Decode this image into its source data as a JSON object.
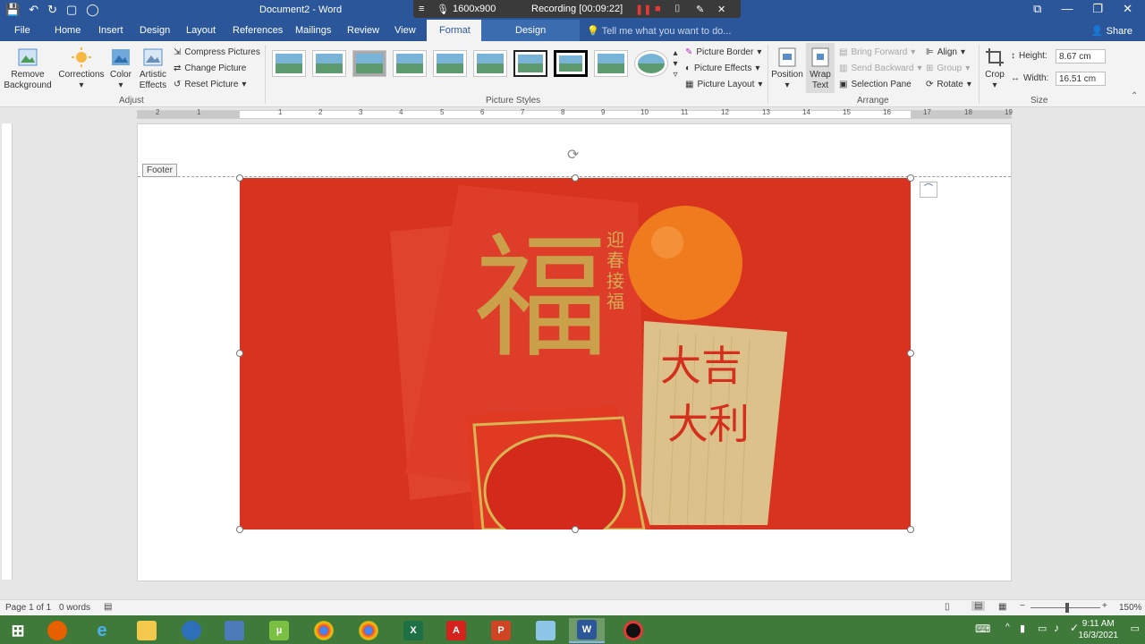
{
  "title_bar": {
    "document_title": "Document2 - Word"
  },
  "recording_bar": {
    "resolution": "1600x900",
    "status": "Recording [00:09:22]"
  },
  "ribbon_tabs": [
    {
      "label": "File"
    },
    {
      "label": "Home"
    },
    {
      "label": "Insert"
    },
    {
      "label": "Design"
    },
    {
      "label": "Layout"
    },
    {
      "label": "References"
    },
    {
      "label": "Mailings"
    },
    {
      "label": "Review"
    },
    {
      "label": "View"
    },
    {
      "label": "Format"
    },
    {
      "label": "Design"
    }
  ],
  "tell_me": {
    "placeholder": "Tell me what you want to do..."
  },
  "share_label": "Share",
  "adjust": {
    "remove_background": "Remove Background",
    "corrections": "Corrections",
    "color": "Color",
    "artistic_effects": "Artistic Effects",
    "compress_pictures": "Compress Pictures",
    "change_picture": "Change Picture",
    "reset_picture": "Reset Picture",
    "group_label": "Adjust"
  },
  "picture_styles": {
    "picture_border": "Picture Border",
    "picture_effects": "Picture Effects",
    "picture_layout": "Picture Layout",
    "group_label": "Picture Styles"
  },
  "arrange": {
    "position": "Position",
    "wrap_text": "Wrap Text",
    "bring_forward": "Bring Forward",
    "send_backward": "Send Backward",
    "selection_pane": "Selection Pane",
    "align": "Align",
    "group": "Group",
    "rotate": "Rotate",
    "group_label": "Arrange"
  },
  "size": {
    "crop": "Crop",
    "height_label": "Height:",
    "height_value": "8.67 cm",
    "width_label": "Width:",
    "width_value": "16.51 cm",
    "group_label": "Size"
  },
  "ruler_numbers": [
    "2",
    "1",
    "1",
    "2",
    "3",
    "4",
    "5",
    "6",
    "7",
    "8",
    "9",
    "10",
    "11",
    "12",
    "13",
    "14",
    "15",
    "16",
    "17",
    "18",
    "19"
  ],
  "document": {
    "footer_label": "Footer",
    "picture_texts": {
      "left_char": "福",
      "vertical_text": "迎春接福",
      "card_line_1": "大吉",
      "card_line_2": "大利"
    }
  },
  "status_bar": {
    "page": "Page 1 of 1",
    "words": "0 words",
    "zoom": "150%"
  },
  "taskbar": {
    "time": "9:11 AM",
    "date": "16/3/2021"
  },
  "colors": {
    "word_blue": "#2b579a",
    "taskbar_green": "#3f7a3a",
    "envelope_red": "#d8321f"
  }
}
